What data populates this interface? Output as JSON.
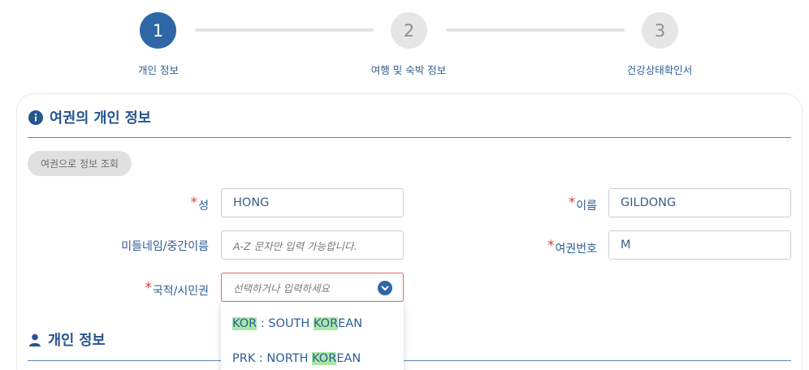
{
  "stepper": {
    "steps": [
      {
        "number": "1",
        "label": "개인 정보"
      },
      {
        "number": "2",
        "label": "여행 및 숙박 정보"
      },
      {
        "number": "3",
        "label": "건강상태확인서"
      }
    ]
  },
  "passport_section": {
    "title": "여권의 개인 정보",
    "lookup_button": "여권으로 정보 조회",
    "surname": {
      "required_mark": "*",
      "label": "성",
      "value": "HONG"
    },
    "given_name": {
      "required_mark": "*",
      "label": "이름",
      "value": "GILDONG"
    },
    "middle_name": {
      "label": "미들네임/중간이름",
      "placeholder": "A-Z 문자만 입력 가능합니다."
    },
    "passport_number": {
      "required_mark": "*",
      "label": "여권번호",
      "value": "M"
    },
    "nationality": {
      "required_mark": "*",
      "label": "국적/시민권",
      "placeholder": "선택하거나 입력하세요"
    }
  },
  "nationality_dropdown": {
    "options": [
      {
        "code": "KOR",
        "separator": " : SOUTH ",
        "match": "KOR",
        "rest": "EAN"
      },
      {
        "code": "PRK",
        "separator": " : NORTH ",
        "match": "KOR",
        "rest": "EAN"
      }
    ]
  },
  "personal_section": {
    "title": "개인 정보"
  },
  "colors": {
    "accent": "#2f67a6",
    "heading": "#26558f",
    "required": "#e03a3a",
    "highlight": "#a9e8a4"
  }
}
